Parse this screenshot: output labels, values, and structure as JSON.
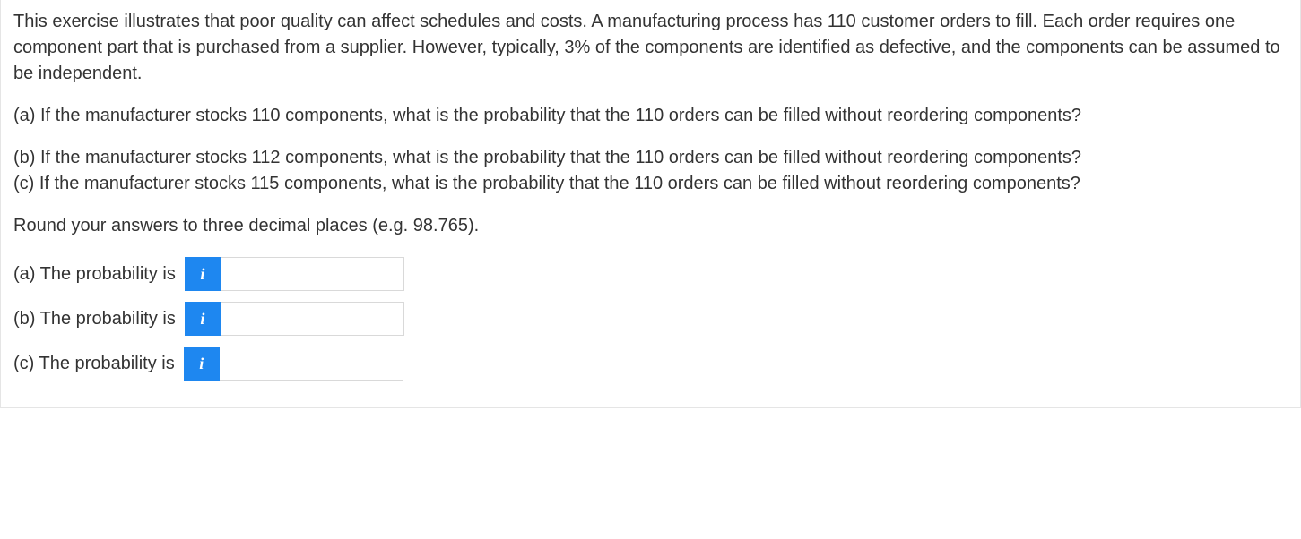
{
  "intro": "This exercise illustrates that poor quality can affect schedules and costs. A manufacturing process has 110 customer orders to fill. Each order requires one component part that is purchased from a supplier. However, typically, 3% of the components are identified as defective, and the components can be assumed to be independent.",
  "qa": "(a) If the manufacturer stocks 110 components, what is the probability that the 110 orders can be filled without reordering components?",
  "qb": "(b) If the manufacturer stocks 112 components, what is the probability that the 110 orders can be filled without reordering components?",
  "qc": "(c) If the manufacturer stocks 115 components, what is the probability that the 110 orders can be filled without reordering components?",
  "round_instruction": "Round your answers to three decimal places (e.g. 98.765).",
  "answers": {
    "a_label": "(a) The probability is",
    "b_label": "(b) The probability is",
    "c_label": "(c) The probability is",
    "info_icon": "i",
    "a_value": "",
    "b_value": "",
    "c_value": ""
  }
}
